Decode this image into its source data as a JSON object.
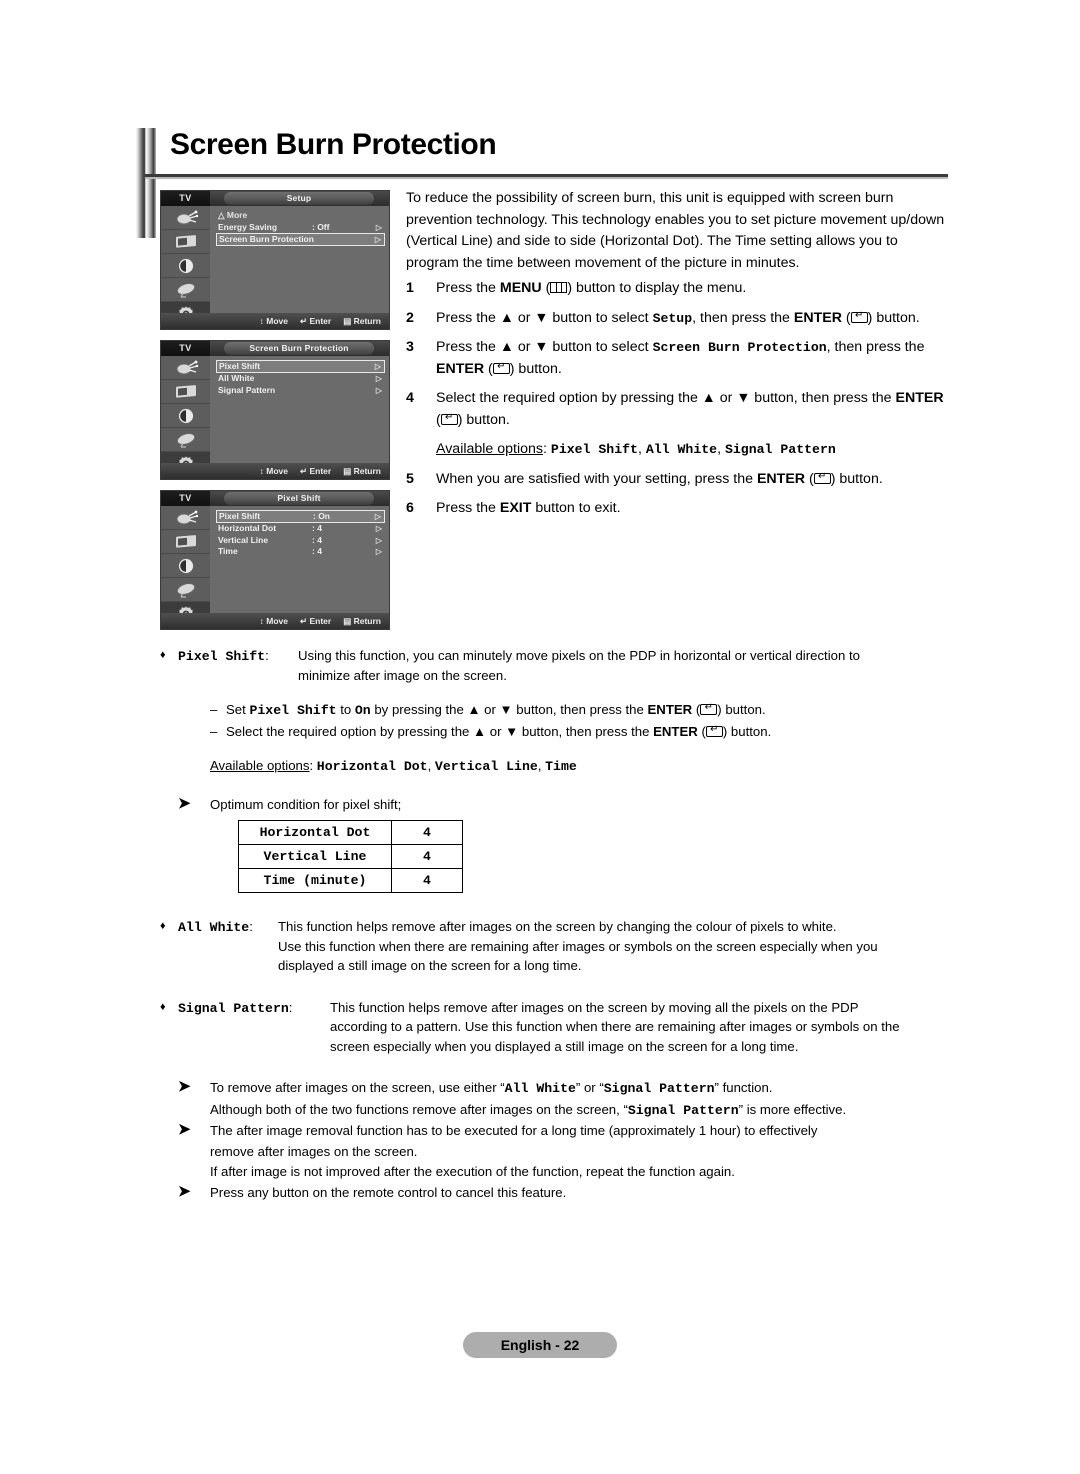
{
  "page": {
    "title": "Screen Burn Protection",
    "footer_label": "English - 22"
  },
  "intro": {
    "paragraph": "To reduce the possibility of screen burn, this unit is equipped with screen burn prevention technology. This technology enables you to set picture movement up/down (Vertical Line) and side to side (Horizontal Dot). The Time setting allows you to program the time between movement of the picture in minutes."
  },
  "steps": [
    {
      "num": "1",
      "parts": [
        {
          "t": "Press the ",
          "style": "plain"
        },
        {
          "t": "MENU",
          "style": "bold"
        },
        {
          "t": " (",
          "style": "plain"
        },
        {
          "t": "menu-key-icon",
          "style": "icon"
        },
        {
          "t": ") button to display the menu.",
          "style": "plain"
        }
      ]
    },
    {
      "num": "2",
      "parts": [
        {
          "t": "Press the ▲ or ▼ button to select ",
          "style": "plain"
        },
        {
          "t": "Setup",
          "style": "mono"
        },
        {
          "t": ", then press the ",
          "style": "plain"
        },
        {
          "t": "ENTER",
          "style": "bold"
        },
        {
          "t": " (",
          "style": "plain"
        },
        {
          "t": "enter-key-icon",
          "style": "icon"
        },
        {
          "t": ") button.",
          "style": "plain"
        }
      ]
    },
    {
      "num": "3",
      "parts": [
        {
          "t": "Press the ▲ or ▼ button to select ",
          "style": "plain"
        },
        {
          "t": "Screen Burn Protection",
          "style": "mono"
        },
        {
          "t": ", then press the ",
          "style": "plain"
        },
        {
          "t": "ENTER",
          "style": "bold"
        },
        {
          "t": " (",
          "style": "plain"
        },
        {
          "t": "enter-key-icon",
          "style": "icon"
        },
        {
          "t": ") button.",
          "style": "plain"
        }
      ]
    },
    {
      "num": "4",
      "parts": [
        {
          "t": "Select the required option by pressing the ▲ or ▼ button, then press the ",
          "style": "plain"
        },
        {
          "t": "ENTER",
          "style": "bold"
        },
        {
          "t": " (",
          "style": "plain"
        },
        {
          "t": "enter-key-icon",
          "style": "icon"
        },
        {
          "t": ") button.",
          "style": "plain"
        }
      ]
    },
    {
      "num": "5",
      "parts": [
        {
          "t": "When you are satisfied with your setting, press the ",
          "style": "plain"
        },
        {
          "t": "ENTER",
          "style": "bold"
        },
        {
          "t": " (",
          "style": "plain"
        },
        {
          "t": "enter-key-icon",
          "style": "icon"
        },
        {
          "t": ") button.",
          "style": "plain"
        }
      ]
    },
    {
      "num": "6",
      "parts": [
        {
          "t": "Press the ",
          "style": "plain"
        },
        {
          "t": "EXIT",
          "style": "bold"
        },
        {
          "t": " button to exit.",
          "style": "plain"
        }
      ]
    }
  ],
  "available_options_step4": {
    "label": "Available options",
    "separator": ": ",
    "options": [
      "Pixel Shift",
      "All White",
      "Signal Pattern"
    ]
  },
  "available_options_pixel_shift": {
    "label": "Available options",
    "separator": ": ",
    "options": [
      "Horizontal Dot",
      "Vertical Line",
      "Time"
    ]
  },
  "osd_menus": [
    {
      "tv_label": "TV",
      "title": "Setup",
      "sidebar_icons": [
        "input-source-icon",
        "picture-icon",
        "sound-icon",
        "channel-dish-icon",
        "setup-gear-icon"
      ],
      "active_icon_index": 4,
      "rows": [
        {
          "label": "△ More",
          "value": "",
          "arrow": false,
          "selected": false,
          "style": "more"
        },
        {
          "label": "Energy Saving",
          "value": ": Off",
          "arrow": true,
          "selected": false,
          "style": "normal"
        },
        {
          "label": "Screen Burn Protection",
          "value": "",
          "arrow": true,
          "selected": true,
          "style": "normal"
        }
      ],
      "footer_hints": [
        "Move",
        "Enter",
        "Return"
      ]
    },
    {
      "tv_label": "TV",
      "title": "Screen Burn Protection",
      "sidebar_icons": [
        "input-source-icon",
        "picture-icon",
        "sound-icon",
        "channel-dish-icon",
        "setup-gear-icon"
      ],
      "active_icon_index": 4,
      "rows": [
        {
          "label": "Pixel Shift",
          "value": "",
          "arrow": true,
          "selected": true,
          "style": "normal"
        },
        {
          "label": "All White",
          "value": "",
          "arrow": true,
          "selected": false,
          "style": "normal"
        },
        {
          "label": "Signal Pattern",
          "value": "",
          "arrow": true,
          "selected": false,
          "style": "normal"
        }
      ],
      "footer_hints": [
        "Move",
        "Enter",
        "Return"
      ]
    },
    {
      "tv_label": "TV",
      "title": "Pixel Shift",
      "sidebar_icons": [
        "input-source-icon",
        "picture-icon",
        "sound-icon",
        "channel-dish-icon",
        "setup-gear-icon"
      ],
      "active_icon_index": 4,
      "rows": [
        {
          "label": "Pixel Shift",
          "value": ": On",
          "arrow": true,
          "selected": true,
          "style": "normal"
        },
        {
          "label": "Horizontal Dot",
          "value": ": 4",
          "arrow": true,
          "selected": false,
          "style": "normal"
        },
        {
          "label": "Vertical Line",
          "value": ": 4",
          "arrow": true,
          "selected": false,
          "style": "normal"
        },
        {
          "label": "Time",
          "value": ": 4",
          "arrow": true,
          "selected": false,
          "style": "normal"
        }
      ],
      "footer_hints": [
        "Move",
        "Enter",
        "Return"
      ]
    }
  ],
  "pixel_shift_section": {
    "term": "Pixel Shift",
    "colon": ": ",
    "description_line1": "Using this function, you can minutely move pixels on the PDP in horizontal or vertical direction to",
    "description_line2": "minimize after image on the screen.",
    "dash_items": [
      [
        {
          "t": "Set ",
          "style": "plain"
        },
        {
          "t": "Pixel Shift",
          "style": "mono"
        },
        {
          "t": " to ",
          "style": "plain"
        },
        {
          "t": "On",
          "style": "mono"
        },
        {
          "t": " by pressing the ▲ or ▼ button, then press the ",
          "style": "plain"
        },
        {
          "t": "ENTER",
          "style": "bold"
        },
        {
          "t": " (",
          "style": "plain"
        },
        {
          "t": "enter-key-icon",
          "style": "icon"
        },
        {
          "t": ") button.",
          "style": "plain"
        }
      ],
      [
        {
          "t": "Select the required option by pressing the ▲ or ▼ button, then press the ",
          "style": "plain"
        },
        {
          "t": "ENTER",
          "style": "bold"
        },
        {
          "t": " (",
          "style": "plain"
        },
        {
          "t": "enter-key-icon",
          "style": "icon"
        },
        {
          "t": ") button.",
          "style": "plain"
        }
      ]
    ]
  },
  "optimum": {
    "heading": "Optimum condition for pixel shift;",
    "rows": [
      {
        "label": "Horizontal Dot",
        "value": "4"
      },
      {
        "label": "Vertical Line",
        "value": "4"
      },
      {
        "label": "Time (minute)",
        "value": "4"
      }
    ]
  },
  "all_white_section": {
    "term": "All White",
    "colon": ": ",
    "lines": [
      "This function helps remove after images on the screen by changing the colour of pixels to white.",
      "Use this function when there are remaining after images or symbols on the screen especially when you",
      "displayed a still image on the screen for a long time."
    ]
  },
  "signal_pattern_section": {
    "term": "Signal Pattern",
    "colon": ": ",
    "lines": [
      "This function helps remove after images on the screen by moving all the pixels on the PDP",
      "according to a pattern. Use this function when there are remaining after images or symbols on the",
      "screen especially when you displayed a still image on the screen for a long time."
    ]
  },
  "notes": [
    {
      "parts": [
        {
          "t": "To remove after images on the screen, use either “",
          "style": "plain"
        },
        {
          "t": "All White",
          "style": "mono"
        },
        {
          "t": "” or “",
          "style": "plain"
        },
        {
          "t": "Signal Pattern",
          "style": "mono"
        },
        {
          "t": "” function.",
          "style": "plain"
        }
      ]
    },
    {
      "parts": [
        {
          "t": "Although both of the two functions remove after images on the screen, “",
          "style": "plain"
        },
        {
          "t": "Signal Pattern",
          "style": "mono"
        },
        {
          "t": "” is more effective.",
          "style": "plain"
        }
      ],
      "no_marker": true
    },
    {
      "parts": [
        {
          "t": "The after image removal function has to be executed for a long time (approximately 1 hour) to effectively",
          "style": "plain"
        }
      ]
    },
    {
      "parts": [
        {
          "t": "remove after images on the screen.",
          "style": "plain"
        }
      ],
      "no_marker": true
    },
    {
      "parts": [
        {
          "t": "If after image is not improved after the execution of the function, repeat the function again.",
          "style": "plain"
        }
      ],
      "no_marker": true
    },
    {
      "parts": [
        {
          "t": "Press any button on the remote control to cancel this feature.",
          "style": "plain"
        }
      ]
    }
  ],
  "glyphs": {
    "diamond": "♦",
    "arrow_marker": "➤",
    "dash": "–",
    "triangle_right": "▷",
    "updown": "↕"
  }
}
